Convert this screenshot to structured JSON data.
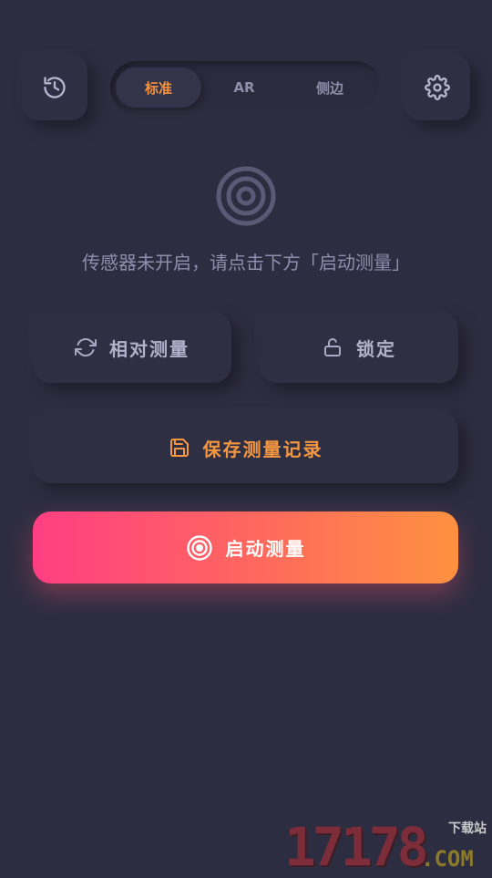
{
  "header": {
    "history_icon": "history-icon",
    "settings_icon": "gear-icon",
    "tabs": [
      {
        "label": "标准",
        "active": true
      },
      {
        "label": "AR",
        "active": false
      },
      {
        "label": "侧边",
        "active": false
      }
    ]
  },
  "main": {
    "target_icon": "target-icon",
    "status_text": "传感器未开启，请点击下方「启动测量」"
  },
  "actions": {
    "relative_label": "相对测量",
    "lock_label": "锁定",
    "save_label": "保存测量记录",
    "start_label": "启动测量"
  },
  "watermark": {
    "digits": "17178",
    "dotcom": ".COM",
    "tag": "下载站"
  },
  "colors": {
    "background": "#2d2d41",
    "accent_orange": "#f5923e",
    "gradient_start": "#ff3e83",
    "gradient_end": "#ff9140"
  }
}
